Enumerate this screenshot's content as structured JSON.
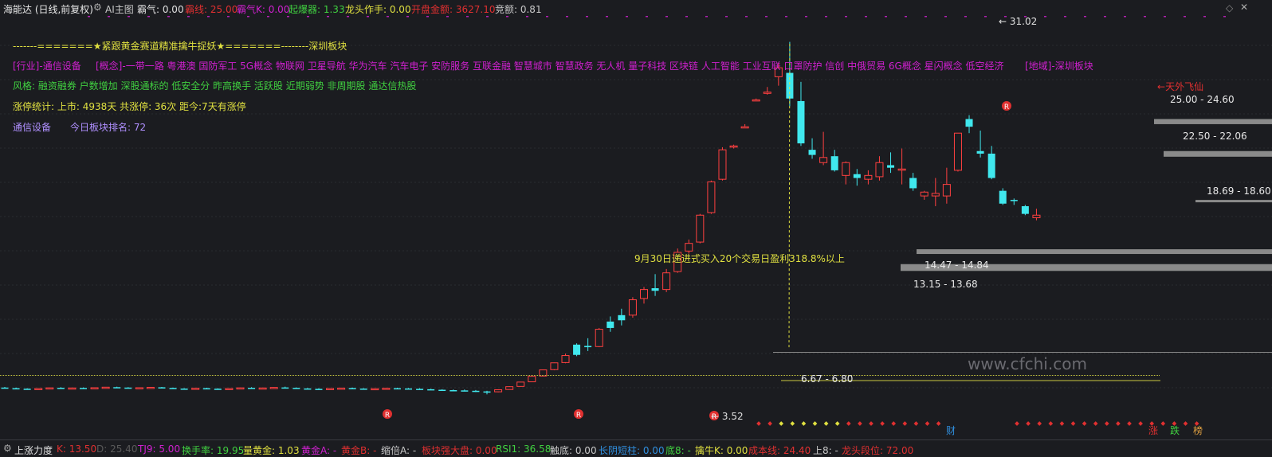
{
  "topbar": {
    "title": "海能达 (日线,前复权)",
    "ai_label": "AI主图",
    "items": [
      {
        "label": "霸气: 0.00",
        "color": "#e0e0e0"
      },
      {
        "label": "霸线: 25.00",
        "color": "#e03030"
      },
      {
        "label": "霸气K: 0.00",
        "color": "#d020d0"
      },
      {
        "label": "起爆器: 1.33",
        "color": "#40d040"
      },
      {
        "label": "龙头作手: 0.00",
        "color": "#e0e040"
      },
      {
        "label": "开盘金额: 3627.10",
        "color": "#e03030"
      },
      {
        "label": "竞额: 0.81",
        "color": "#c8c8c8"
      }
    ]
  },
  "info": {
    "banner": "-------=======★紧跟黄金赛道精准擒牛捉妖★=======--------深圳板块",
    "industry": "[行业]-通信设备",
    "concepts": "[概念]-一带一路  粤港澳  国防军工  5G概念  物联网  卫星导航  华为汽车  汽车电子  安防服务  互联金融  智慧城市  智慧政务  无人机  量子科技  区块链  人工智能  工业互联  口罩防护  信创  中俄贸易  6G概念  星闪概念  低空经济",
    "region": "[地域]-深圳板块",
    "style": "风格: 融资融券  户数增加  深股通标的  低安全分  昨高换手  活跃股  近期弱势  非周期股  通达信热股",
    "stats": "涨停统计:     上市: 4938天     共涨停: 36次     距今:7天有涨停",
    "sector": "通信设备",
    "rank": "今日板块排名:  72"
  },
  "annotations": {
    "peak": "31.02",
    "promo": "9月30日递进式买入20个交易日盈利318.8%以上",
    "tianwai": "天外飞仙",
    "zone_a": "25.00 - 24.60",
    "zone_b": "22.50 - 22.06",
    "zone_c": "18.69 - 18.60",
    "zone_d": "14.47 - 14.84",
    "zone_e": "13.15 - 13.68",
    "zone_f": "6.67 - 6.80",
    "low": "3.52",
    "watermark": "www.cfchi.com",
    "mark_cai": "财",
    "mark_zhang": "涨",
    "mark_die": "跌",
    "mark_bang": "榜"
  },
  "botbar": {
    "title": "上涨力度",
    "items": [
      {
        "label": "K: 13.50",
        "color": "#e03030"
      },
      {
        "label": "D: 25.40",
        "color": "#5a5a5a"
      },
      {
        "label": "TJ9: 5.00",
        "color": "#d020d0"
      },
      {
        "label": "换手率: 19.95",
        "color": "#40d040"
      },
      {
        "label": "量黄金: 1.03",
        "color": "#e0e040"
      },
      {
        "label": "黄金A: -",
        "color": "#d020d0"
      },
      {
        "label": "黄金B: -",
        "color": "#e03030"
      },
      {
        "label": "缩倍A: -",
        "color": "#c8c8c8"
      },
      {
        "label": "板块强大盘: 0.00",
        "color": "#e03030"
      },
      {
        "label": "RSI1: 36.58",
        "color": "#40d040"
      },
      {
        "label": "触底: 0.00",
        "color": "#c8c8c8"
      },
      {
        "label": "长阴短柱: 0.00",
        "color": "#3090e0"
      },
      {
        "label": "底8: -",
        "color": "#40d040"
      },
      {
        "label": "擒牛K: 0.00",
        "color": "#e0e040"
      },
      {
        "label": "成本线: 24.40",
        "color": "#e03030"
      },
      {
        "label": "上8: -",
        "color": "#c8c8c8"
      },
      {
        "label": "龙头段位: 72.00",
        "color": "#e03030"
      }
    ]
  },
  "chart_data": {
    "type": "candlestick",
    "title": "海能达 (日线,前复权)",
    "peak_label": 31.02,
    "low_label": 3.52,
    "price_zones": [
      {
        "low": 24.6,
        "high": 25.0
      },
      {
        "low": 22.06,
        "high": 22.5
      },
      {
        "low": 18.6,
        "high": 18.69
      },
      {
        "low": 14.47,
        "high": 14.84
      },
      {
        "low": 13.15,
        "high": 13.68
      },
      {
        "low": 6.67,
        "high": 6.8
      }
    ],
    "candles": [
      {
        "o": 4.05,
        "h": 4.1,
        "l": 4.0,
        "c": 4.02,
        "up": false
      },
      {
        "o": 4.0,
        "h": 4.05,
        "l": 3.95,
        "c": 3.97,
        "up": false
      },
      {
        "o": 3.96,
        "h": 4.0,
        "l": 3.9,
        "c": 3.92,
        "up": false
      },
      {
        "o": 3.92,
        "h": 4.0,
        "l": 3.9,
        "c": 3.98,
        "up": true
      },
      {
        "o": 3.98,
        "h": 4.05,
        "l": 3.95,
        "c": 4.03,
        "up": true
      },
      {
        "o": 4.03,
        "h": 4.08,
        "l": 3.98,
        "c": 4.0,
        "up": false
      },
      {
        "o": 4.0,
        "h": 4.05,
        "l": 3.95,
        "c": 4.02,
        "up": true
      },
      {
        "o": 4.02,
        "h": 4.06,
        "l": 3.97,
        "c": 3.99,
        "up": false
      },
      {
        "o": 3.99,
        "h": 4.06,
        "l": 3.96,
        "c": 4.04,
        "up": true
      },
      {
        "o": 4.04,
        "h": 4.1,
        "l": 4.0,
        "c": 4.08,
        "up": true
      },
      {
        "o": 4.08,
        "h": 4.12,
        "l": 4.02,
        "c": 4.05,
        "up": false
      },
      {
        "o": 4.05,
        "h": 4.08,
        "l": 3.98,
        "c": 4.0,
        "up": false
      },
      {
        "o": 4.0,
        "h": 4.06,
        "l": 3.96,
        "c": 4.04,
        "up": true
      },
      {
        "o": 4.04,
        "h": 4.1,
        "l": 4.0,
        "c": 4.07,
        "up": true
      },
      {
        "o": 4.07,
        "h": 4.1,
        "l": 4.0,
        "c": 4.02,
        "up": false
      },
      {
        "o": 4.02,
        "h": 4.05,
        "l": 3.95,
        "c": 3.97,
        "up": false
      },
      {
        "o": 3.97,
        "h": 4.0,
        "l": 3.9,
        "c": 3.95,
        "up": false
      },
      {
        "o": 3.95,
        "h": 4.02,
        "l": 3.92,
        "c": 4.0,
        "up": true
      },
      {
        "o": 4.0,
        "h": 4.04,
        "l": 3.94,
        "c": 3.96,
        "up": false
      },
      {
        "o": 3.96,
        "h": 4.0,
        "l": 3.9,
        "c": 3.94,
        "up": false
      },
      {
        "o": 3.94,
        "h": 4.0,
        "l": 3.9,
        "c": 3.98,
        "up": true
      },
      {
        "o": 3.98,
        "h": 4.05,
        "l": 3.94,
        "c": 4.03,
        "up": true
      },
      {
        "o": 4.03,
        "h": 4.08,
        "l": 3.98,
        "c": 4.0,
        "up": false
      },
      {
        "o": 4.0,
        "h": 4.05,
        "l": 3.96,
        "c": 4.02,
        "up": true
      },
      {
        "o": 4.02,
        "h": 4.08,
        "l": 3.98,
        "c": 4.06,
        "up": true
      },
      {
        "o": 4.06,
        "h": 4.12,
        "l": 4.0,
        "c": 4.03,
        "up": false
      },
      {
        "o": 4.03,
        "h": 4.06,
        "l": 3.96,
        "c": 3.98,
        "up": false
      },
      {
        "o": 3.98,
        "h": 4.02,
        "l": 3.92,
        "c": 3.95,
        "up": false
      },
      {
        "o": 3.95,
        "h": 4.0,
        "l": 3.9,
        "c": 3.93,
        "up": false
      },
      {
        "o": 3.93,
        "h": 4.0,
        "l": 3.9,
        "c": 3.98,
        "up": true
      },
      {
        "o": 3.98,
        "h": 4.04,
        "l": 3.94,
        "c": 4.01,
        "up": true
      },
      {
        "o": 4.01,
        "h": 4.05,
        "l": 3.95,
        "c": 3.97,
        "up": false
      },
      {
        "o": 3.97,
        "h": 4.0,
        "l": 3.9,
        "c": 3.94,
        "up": false
      },
      {
        "o": 3.94,
        "h": 4.0,
        "l": 3.9,
        "c": 3.97,
        "up": true
      },
      {
        "o": 3.97,
        "h": 4.03,
        "l": 3.93,
        "c": 4.0,
        "up": true
      },
      {
        "o": 4.0,
        "h": 4.04,
        "l": 3.95,
        "c": 3.98,
        "up": false
      },
      {
        "o": 3.98,
        "h": 4.02,
        "l": 3.92,
        "c": 3.95,
        "up": false
      },
      {
        "o": 3.95,
        "h": 4.0,
        "l": 3.9,
        "c": 3.92,
        "up": false
      },
      {
        "o": 3.92,
        "h": 3.96,
        "l": 3.85,
        "c": 3.88,
        "up": false
      },
      {
        "o": 3.88,
        "h": 3.92,
        "l": 3.8,
        "c": 3.85,
        "up": false
      },
      {
        "o": 3.85,
        "h": 3.9,
        "l": 3.8,
        "c": 3.83,
        "up": false
      },
      {
        "o": 3.83,
        "h": 3.9,
        "l": 3.75,
        "c": 3.8,
        "up": false
      },
      {
        "o": 3.8,
        "h": 3.86,
        "l": 3.7,
        "c": 3.75,
        "up": false
      },
      {
        "o": 3.75,
        "h": 3.8,
        "l": 3.52,
        "c": 3.7,
        "up": false
      },
      {
        "o": 3.72,
        "h": 3.9,
        "l": 3.68,
        "c": 3.88,
        "up": true
      },
      {
        "o": 3.9,
        "h": 4.15,
        "l": 3.88,
        "c": 4.12,
        "up": true
      },
      {
        "o": 4.14,
        "h": 4.5,
        "l": 4.12,
        "c": 4.48,
        "up": true
      },
      {
        "o": 4.5,
        "h": 4.95,
        "l": 4.48,
        "c": 4.93,
        "up": true
      },
      {
        "o": 4.95,
        "h": 5.45,
        "l": 4.93,
        "c": 5.43,
        "up": true
      },
      {
        "o": 5.45,
        "h": 6.0,
        "l": 5.4,
        "c": 5.98,
        "up": true
      },
      {
        "o": 6.0,
        "h": 6.7,
        "l": 5.95,
        "c": 6.55,
        "up": true
      },
      {
        "o": 6.6,
        "h": 7.5,
        "l": 6.5,
        "c": 7.4,
        "up": false
      },
      {
        "o": 7.3,
        "h": 7.9,
        "l": 6.9,
        "c": 7.2,
        "up": false
      },
      {
        "o": 7.25,
        "h": 8.7,
        "l": 7.2,
        "c": 8.6,
        "up": true
      },
      {
        "o": 8.7,
        "h": 9.6,
        "l": 8.4,
        "c": 9.2,
        "up": false
      },
      {
        "o": 9.3,
        "h": 10.2,
        "l": 8.9,
        "c": 9.7,
        "up": false
      },
      {
        "o": 9.7,
        "h": 11.1,
        "l": 9.5,
        "c": 10.9,
        "up": true
      },
      {
        "o": 11.0,
        "h": 11.9,
        "l": 10.6,
        "c": 11.7,
        "up": true
      },
      {
        "o": 11.8,
        "h": 12.9,
        "l": 11.2,
        "c": 11.6,
        "up": false
      },
      {
        "o": 11.7,
        "h": 13.3,
        "l": 11.5,
        "c": 13.0,
        "up": true
      },
      {
        "o": 13.1,
        "h": 14.9,
        "l": 13.0,
        "c": 14.6,
        "up": true
      },
      {
        "o": 14.7,
        "h": 15.6,
        "l": 14.5,
        "c": 15.3,
        "up": true
      },
      {
        "o": 15.4,
        "h": 17.6,
        "l": 15.3,
        "c": 17.5,
        "up": true
      },
      {
        "o": 17.7,
        "h": 20.2,
        "l": 17.6,
        "c": 20.1,
        "up": true
      },
      {
        "o": 20.3,
        "h": 22.8,
        "l": 20.2,
        "c": 22.6,
        "up": true
      },
      {
        "o": 22.9,
        "h": 23.0,
        "l": 22.7,
        "c": 22.9,
        "up": true
      },
      {
        "o": 24.3,
        "h": 24.6,
        "l": 24.3,
        "c": 24.4,
        "up": true
      },
      {
        "o": 26.5,
        "h": 26.6,
        "l": 26.4,
        "c": 26.5,
        "up": true
      },
      {
        "o": 27.0,
        "h": 27.5,
        "l": 26.9,
        "c": 27.1,
        "up": true
      },
      {
        "o": 28.3,
        "h": 29.4,
        "l": 27.6,
        "c": 29.0,
        "up": true
      },
      {
        "o": 28.6,
        "h": 31.02,
        "l": 26.0,
        "c": 26.6,
        "up": false
      },
      {
        "o": 26.4,
        "h": 27.9,
        "l": 22.9,
        "c": 23.1,
        "up": false
      },
      {
        "o": 22.6,
        "h": 23.5,
        "l": 21.9,
        "c": 22.2,
        "up": false
      },
      {
        "o": 21.6,
        "h": 24.0,
        "l": 21.4,
        "c": 22.0,
        "up": true
      },
      {
        "o": 22.1,
        "h": 22.6,
        "l": 20.9,
        "c": 21.0,
        "up": false
      },
      {
        "o": 20.6,
        "h": 21.7,
        "l": 19.9,
        "c": 21.6,
        "up": true
      },
      {
        "o": 20.7,
        "h": 21.1,
        "l": 19.8,
        "c": 20.4,
        "up": false
      },
      {
        "o": 20.3,
        "h": 21.0,
        "l": 19.9,
        "c": 20.6,
        "up": true
      },
      {
        "o": 20.5,
        "h": 22.1,
        "l": 20.2,
        "c": 21.6,
        "up": true
      },
      {
        "o": 21.2,
        "h": 22.4,
        "l": 20.8,
        "c": 21.4,
        "up": false
      },
      {
        "o": 21.1,
        "h": 22.7,
        "l": 19.9,
        "c": 21.1,
        "up": true
      },
      {
        "o": 20.4,
        "h": 20.8,
        "l": 19.4,
        "c": 19.6,
        "up": false
      },
      {
        "o": 19.3,
        "h": 19.4,
        "l": 18.7,
        "c": 19.0,
        "up": true
      },
      {
        "o": 19.2,
        "h": 20.4,
        "l": 18.2,
        "c": 19.0,
        "up": true
      },
      {
        "o": 19.0,
        "h": 21.2,
        "l": 18.4,
        "c": 19.9,
        "up": true
      },
      {
        "o": 21.0,
        "h": 23.9,
        "l": 20.9,
        "c": 23.9,
        "up": true
      },
      {
        "o": 25.0,
        "h": 25.3,
        "l": 23.9,
        "c": 24.4,
        "up": false
      },
      {
        "o": 22.5,
        "h": 24.1,
        "l": 22.0,
        "c": 22.3,
        "up": false
      },
      {
        "o": 22.3,
        "h": 22.9,
        "l": 20.3,
        "c": 20.4,
        "up": false
      },
      {
        "o": 19.4,
        "h": 19.6,
        "l": 18.3,
        "c": 18.4,
        "up": false
      },
      {
        "o": 18.69,
        "h": 18.8,
        "l": 18.3,
        "c": 18.6,
        "up": false
      },
      {
        "o": 18.2,
        "h": 18.3,
        "l": 17.5,
        "c": 17.6,
        "up": false
      },
      {
        "o": 17.5,
        "h": 18.0,
        "l": 17.1,
        "c": 17.3,
        "up": true
      }
    ],
    "signal_markers": [
      "R",
      "R",
      "R",
      "R",
      "R"
    ]
  }
}
